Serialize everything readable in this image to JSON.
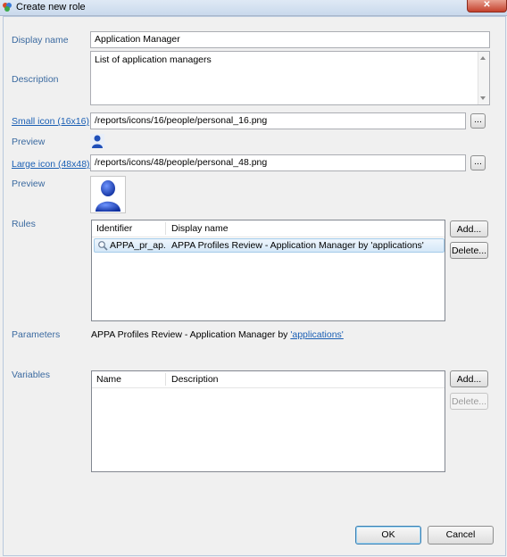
{
  "window": {
    "title": "Create new role",
    "close_label": "✕"
  },
  "form": {
    "display_name_label": "Display name",
    "display_name_value": "Application Manager",
    "description_label": "Description",
    "description_value": "List of application managers",
    "small_icon_label": "Small icon (16x16)",
    "small_icon_value": "/reports/icons/16/people/personal_16.png",
    "small_icon_browse": "...",
    "preview_label_1": "Preview",
    "large_icon_label": "Large icon (48x48)",
    "large_icon_value": "/reports/icons/48/people/personal_48.png",
    "large_icon_browse": "...",
    "preview_label_2": "Preview",
    "rules_label": "Rules",
    "parameters_label": "Parameters",
    "parameters_text": "APPA Profiles Review - Application Manager by ",
    "parameters_link": "'applications'",
    "variables_label": "Variables"
  },
  "rules_table": {
    "columns": [
      "Identifier",
      "Display name"
    ],
    "rows": [
      {
        "identifier": "APPA_pr_ap...",
        "display_name": "APPA Profiles Review - Application Manager by 'applications'"
      }
    ],
    "add_label": "Add...",
    "delete_label": "Delete..."
  },
  "variables_table": {
    "columns": [
      "Name",
      "Description"
    ],
    "rows": [],
    "add_label": "Add...",
    "delete_label": "Delete..."
  },
  "footer": {
    "ok_label": "OK",
    "cancel_label": "Cancel"
  },
  "icons": {
    "app": "roles-app-icon",
    "small_preview": "person-icon",
    "large_preview": "person-icon",
    "row": "magnifier-icon"
  },
  "colors": {
    "label": "#3b6aa0",
    "link": "#1a5fb4",
    "selection": "#d5e8f8"
  }
}
